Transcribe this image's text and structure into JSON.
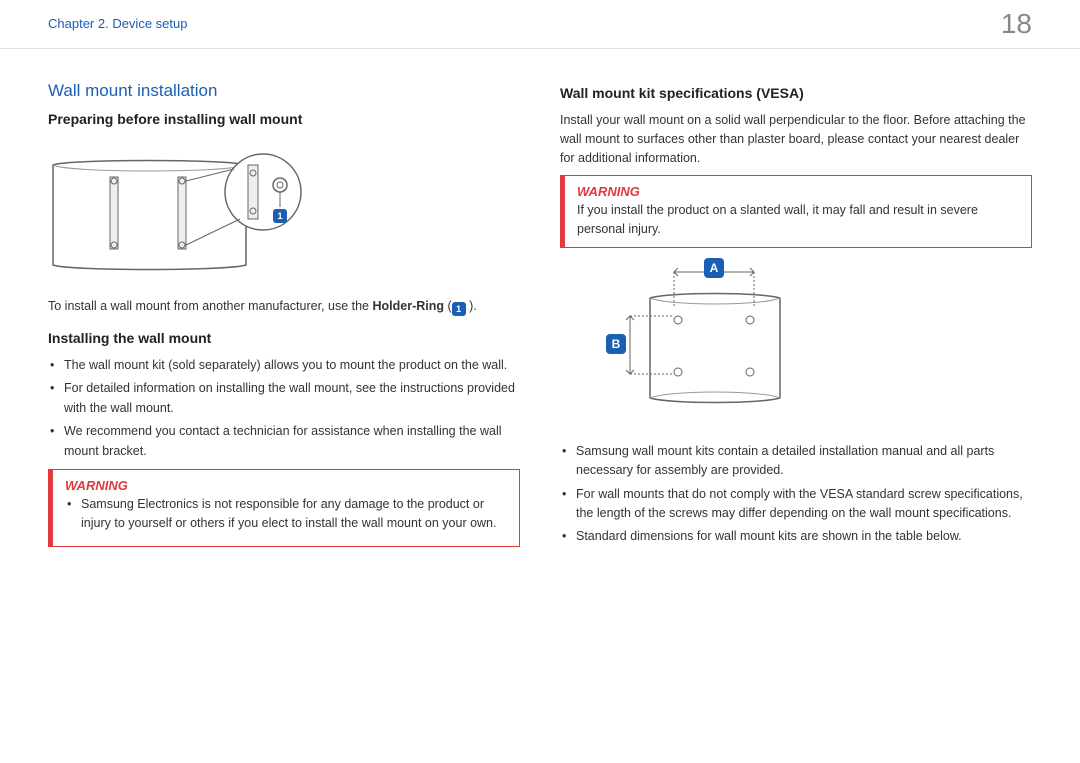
{
  "header": {
    "chapter": "Chapter 2. Device setup",
    "page": "18"
  },
  "left": {
    "section_title": "Wall mount installation",
    "sub1": "Preparing before installing wall mount",
    "note_pre": "To install a wall mount from another manufacturer, use the ",
    "note_bold": "Holder-Ring",
    "note_post": " (",
    "note_marker": "1",
    "note_close": " ).",
    "sub2": "Installing the wall mount",
    "bullets": [
      "The wall mount kit (sold separately) allows you to mount the product on the wall.",
      "For detailed information on installing the wall mount, see the instructions provided with the wall mount.",
      "We recommend you contact a technician for assistance when installing the wall mount bracket."
    ],
    "warning_title": "WARNING",
    "warning_bullets": [
      "Samsung Electronics is not responsible for any damage to the product or injury to yourself or others if you elect to install the wall mount on your own."
    ],
    "fig1_marker": "1"
  },
  "right": {
    "sub1": "Wall mount kit specifications (VESA)",
    "intro": "Install your wall mount on a solid wall perpendicular to the floor. Before attaching the wall mount to surfaces other than plaster board, please contact your nearest dealer for additional information.",
    "warning_title": "WARNING",
    "warning_text": "If you install the product on a slanted wall, it may fall and result in severe personal injury.",
    "labelA": "A",
    "labelB": "B",
    "bullets": [
      "Samsung wall mount kits contain a detailed installation manual and all parts necessary for assembly are provided.",
      "For wall mounts that do not comply with the VESA standard screw specifications, the length of the screws may differ depending on the wall mount specifications.",
      "Standard dimensions for wall mount kits are shown in the table below."
    ]
  }
}
